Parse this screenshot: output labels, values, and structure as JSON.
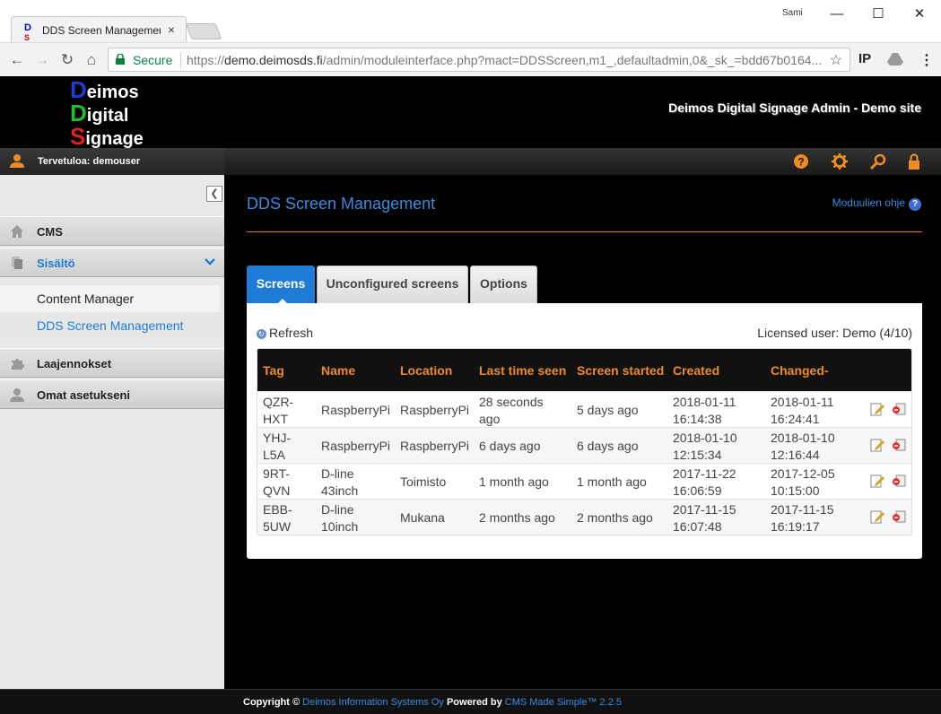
{
  "browser": {
    "tab_title": "DDS Screen Managemen",
    "user": "Sami",
    "minimize": "—",
    "maximize": "☐",
    "close": "✕",
    "secure_label": "Secure",
    "url_scheme": "https://",
    "url_host": "demo.deimosds.fi",
    "url_path": "/admin/moduleinterface.php?mact=DDSScreen,m1_,defaultadmin,0&_sk_=bdd67b0164...",
    "ext_ip": "IP"
  },
  "header": {
    "logo": {
      "l1a": "D",
      "l1b": "eimos",
      "l2a": "D",
      "l2b": "igital",
      "l3a": "S",
      "l3b": "ignage"
    },
    "site_title": "Deimos Digital Signage Admin - Demo site"
  },
  "userbar": {
    "welcome": "Tervetuloa: demouser"
  },
  "sidebar": {
    "items": [
      {
        "label": "CMS"
      },
      {
        "label": "Sisältö"
      },
      {
        "label": "Laajennokset"
      },
      {
        "label": "Omat asetukseni"
      }
    ],
    "subitems": [
      {
        "label": "Content Manager"
      },
      {
        "label": "DDS Screen Management"
      }
    ]
  },
  "main": {
    "title": "DDS Screen Management",
    "help": "Moduulien ohje",
    "tabs": [
      {
        "label": "Screens"
      },
      {
        "label": "Unconfigured screens"
      },
      {
        "label": "Options"
      }
    ],
    "refresh": "Refresh",
    "licensed": "Licensed user: Demo (4/10)",
    "columns": [
      "Tag",
      "Name",
      "Location",
      "Last time seen",
      "Screen started",
      "Created",
      "Changed-"
    ],
    "rows": [
      {
        "tag1": "QZR-",
        "tag2": "HXT",
        "name1": "RaspberryPi",
        "name2": "",
        "location": "RaspberryPi",
        "seen1": "28 seconds",
        "seen2": "ago",
        "started": "5 days ago",
        "created1": "2018-01-11",
        "created2": "16:14:38",
        "changed1": "2018-01-11",
        "changed2": "16:24:41"
      },
      {
        "tag1": "YHJ-",
        "tag2": "L5A",
        "name1": "RaspberryPi",
        "name2": "",
        "location": "RaspberryPi",
        "seen1": "6 days ago",
        "seen2": "",
        "started": "6 days ago",
        "created1": "2018-01-10",
        "created2": "12:15:34",
        "changed1": "2018-01-10",
        "changed2": "12:16:44"
      },
      {
        "tag1": "9RT-",
        "tag2": "QVN",
        "name1": "D-line",
        "name2": "43inch",
        "location": "Toimisto",
        "seen1": "1 month ago",
        "seen2": "",
        "started": "1 month ago",
        "created1": "2017-11-22",
        "created2": "16:06:59",
        "changed1": "2017-12-05",
        "changed2": "10:15:00"
      },
      {
        "tag1": "EBB-",
        "tag2": "5UW",
        "name1": "D-line",
        "name2": "10inch",
        "location": "Mukana",
        "seen1": "2 months ago",
        "seen2": "",
        "started": "2 months ago",
        "created1": "2017-11-15",
        "created2": "16:07:48",
        "changed1": "2017-11-15",
        "changed2": "16:19:17"
      }
    ]
  },
  "footer": {
    "copyright": "Copyright ©",
    "company": "Deimos Information Systems Oy",
    "powered": "Powered by",
    "cms": "CMS Made Simple™ 2.2.5"
  },
  "colors": {
    "accent": "#1e7bd6",
    "orange": "#f08a24"
  }
}
